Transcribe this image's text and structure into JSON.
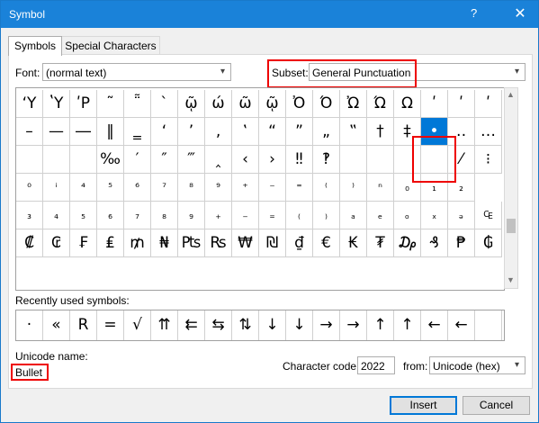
{
  "window": {
    "title": "Symbol",
    "help_label": "?",
    "close_label": "✕"
  },
  "tabs": [
    {
      "label": "Symbols"
    },
    {
      "label": "Special Characters"
    }
  ],
  "font": {
    "label": "Font:",
    "value": "(normal text)"
  },
  "subset": {
    "label": "Subset:",
    "value": "General Punctuation"
  },
  "symbols": [
    [
      "ʻΥ",
      "ʽΥ",
      "ʹΡ",
      "῀",
      "῁",
      "`",
      "ῷ",
      "ώ",
      "ῶ",
      "ῷ",
      "Ὀ",
      "Ό",
      "Ὠ",
      "Ώ",
      "Ω",
      "ʹ",
      "ʹ",
      "ʹ"
    ],
    [
      "–",
      "—",
      "―",
      "‖",
      "‗",
      "‘",
      "’",
      "‚",
      "‛",
      "“",
      "”",
      "„",
      "‟",
      "†",
      "‡",
      "•",
      "‥",
      "…"
    ],
    [
      "",
      "",
      "",
      "‰",
      "′",
      "″",
      "‴",
      "‸",
      "‹",
      "›",
      "‼",
      "‽",
      "",
      "",
      "",
      "",
      "⁄",
      "⁝"
    ],
    [
      "⁰",
      "ⁱ",
      "⁴",
      "⁵",
      "⁶",
      "⁷",
      "⁸",
      "⁹",
      "⁺",
      "⁻",
      "⁼",
      "⁽",
      "⁾",
      "ⁿ",
      "₀",
      "₁",
      "₂"
    ],
    [
      "₃",
      "₄",
      "₅",
      "₆",
      "₇",
      "₈",
      "₉",
      "₊",
      "₋",
      "₌",
      "₍",
      "₎",
      "ₐ",
      "ₑ",
      "ₒ",
      "ₓ",
      "ₔ",
      "₠"
    ],
    [
      "₡",
      "₢",
      "₣",
      "₤",
      "₥",
      "₦",
      "₧",
      "₨",
      "₩",
      "₪",
      "₫",
      "€",
      "₭",
      "₮",
      "₯",
      "₰",
      "₱",
      "₲"
    ]
  ],
  "recent": {
    "label": "Recently used symbols:",
    "items": [
      "·",
      "«",
      "R",
      "=",
      "√",
      "⇈",
      "⇇",
      "⇆",
      "⇅",
      "↓",
      "↓",
      "→",
      "→",
      "↑",
      "↑",
      "←",
      "←",
      ""
    ]
  },
  "unicode_name": {
    "label": "Unicode name:",
    "value": "Bullet"
  },
  "character_code": {
    "label": "Character code:",
    "value": "2022"
  },
  "from": {
    "label": "from:",
    "value": "Unicode (hex)"
  },
  "buttons": {
    "insert": "Insert",
    "cancel": "Cancel"
  }
}
